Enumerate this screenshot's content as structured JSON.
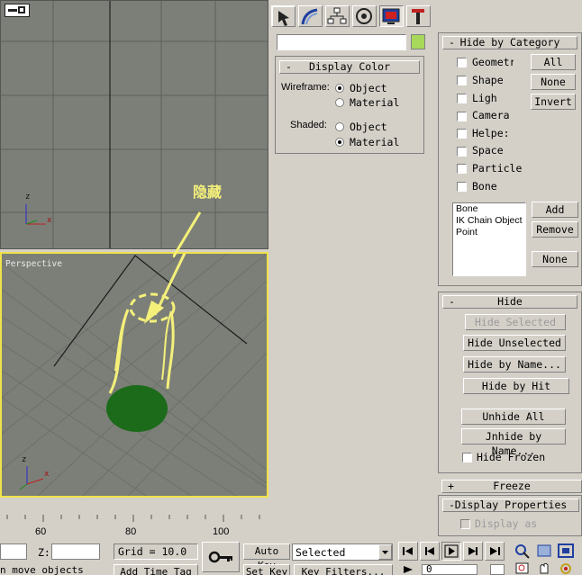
{
  "top_viewport": {
    "axis_z": "z",
    "axis_x": "x"
  },
  "perspective_viewport": {
    "label": "Perspective",
    "annotation": "隐藏",
    "axis_z": "z",
    "axis_x": "x"
  },
  "display_color": {
    "title": "Display Color",
    "wireframe_label": "Wireframe:",
    "shaded_label": "Shaded:",
    "object": "Object",
    "material": "Material"
  },
  "hide_by_category": {
    "title": "Hide by Category",
    "categories": [
      "Geometr",
      "Shape",
      "Ligh",
      "Camera",
      "Helpe:",
      "Space",
      "Particle",
      "Bone"
    ],
    "all": "All",
    "none": "None",
    "invert": "Invert",
    "list": [
      "Bone",
      "IK Chain Object",
      "Point"
    ],
    "add": "Add",
    "remove": "Remove",
    "none2": "None"
  },
  "hide": {
    "title": "Hide",
    "hide_selected": "Hide Selected",
    "hide_unselected": "Hide Unselected",
    "hide_by_name": "Hide by Name...",
    "hide_by_hit": "Hide by Hit",
    "unhide_all": "Unhide All",
    "unhide_by_name": "Jnhide by Name...",
    "hide_frozen": "Hide Frozen"
  },
  "freeze": {
    "title": "Freeze"
  },
  "display_properties": {
    "title": "Display Properties",
    "display_as": "Display as"
  },
  "timeline": {
    "ticks": [
      "60",
      "80",
      "100"
    ]
  },
  "status": {
    "z_label": "Z:",
    "grid": "Grid = 10.0",
    "auto_key": "Auto Key",
    "selected": "Selected",
    "set_key": "Set Key",
    "key_filters": "Key Filters...",
    "prompt": "n move objects",
    "add_time_tag": "Add Time Tag",
    "frame": "0"
  },
  "colors": {
    "viewport_bg": "#7c7f78",
    "active_border": "#f0e24a",
    "annotation": "#f4f07a",
    "object_swatch": "#a8d85a",
    "sphere": "#1c6b1a"
  }
}
